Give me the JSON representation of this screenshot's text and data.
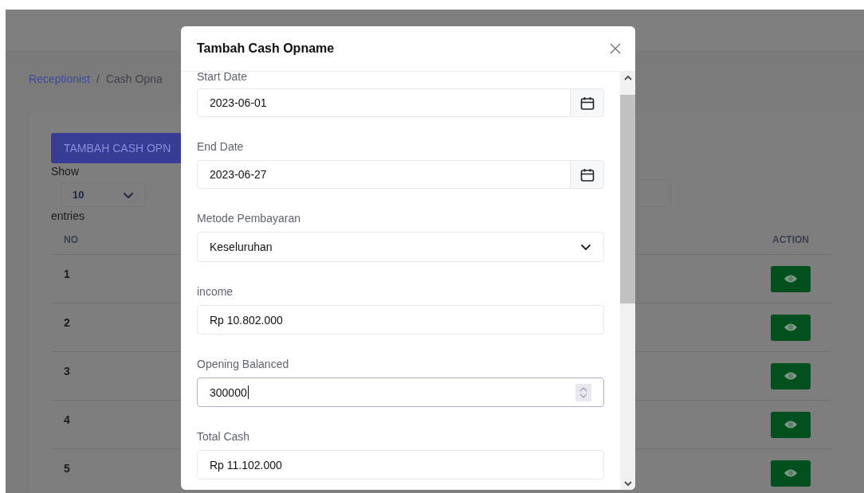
{
  "breadcrumb": {
    "parent": "Receptionist",
    "separator": "/",
    "current": "Cash Opna"
  },
  "add_button": "TAMBAH CASH OPN",
  "length_menu": {
    "show_label": "Show",
    "value": "10",
    "entries_label": "entries"
  },
  "table": {
    "columns": [
      "NO",
      "ACTION"
    ],
    "rows": [
      {
        "no": "1"
      },
      {
        "no": "2"
      },
      {
        "no": "3"
      },
      {
        "no": "4"
      },
      {
        "no": "5"
      }
    ]
  },
  "modal": {
    "title": "Tambah Cash Opname",
    "fields": [
      {
        "kind": "date",
        "label": "Start Date",
        "value": "2023-06-01",
        "focused": false
      },
      {
        "kind": "date",
        "label": "End Date",
        "value": "2023-06-27",
        "focused": false
      },
      {
        "kind": "select",
        "label": "Metode Pembayaran",
        "value": "Keseluruhan",
        "focused": false
      },
      {
        "kind": "text",
        "label": "income",
        "value": "Rp 10.802.000",
        "focused": false
      },
      {
        "kind": "number",
        "label": "Opening Balanced",
        "value": "300000",
        "focused": true
      },
      {
        "kind": "text",
        "label": "Total Cash",
        "value": "Rp 11.102.000",
        "focused": false
      }
    ]
  }
}
